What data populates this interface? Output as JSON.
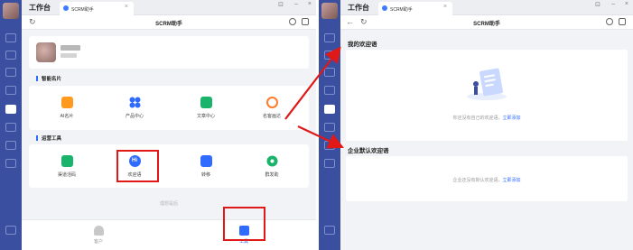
{
  "left_window": {
    "workspace_title": "工作台",
    "tab_label": "SCRM助手",
    "nav_title": "SCRM助手",
    "sections": [
      {
        "title": "智能名片",
        "items": [
          {
            "label": "AI名片",
            "icon": "ai-card-icon",
            "color": "#ff9a1f"
          },
          {
            "label": "产品中心",
            "icon": "product-center-icon",
            "color": "#2f6bff"
          },
          {
            "label": "文章中心",
            "icon": "article-center-icon",
            "color": "#19b36b"
          },
          {
            "label": "名客画达",
            "icon": "customer-profile-icon",
            "color": "#ff7a29"
          }
        ]
      },
      {
        "title": "运营工具",
        "items": [
          {
            "label": "渠道活码",
            "icon": "channel-code-icon",
            "color": "#19b36b"
          },
          {
            "label": "欢迎语",
            "icon": "welcome-message-icon",
            "color": "#2f6bff"
          },
          {
            "label": "转移",
            "icon": "transfer-icon",
            "color": "#2f6bff"
          },
          {
            "label": "群发助",
            "icon": "mass-send-icon",
            "color": "#19b36b"
          }
        ]
      }
    ],
    "hint": "理想是后",
    "bottom_tabs": [
      {
        "label": "客户",
        "icon": "customer-tab-icon"
      },
      {
        "label": "工具",
        "icon": "tools-tab-icon"
      }
    ]
  },
  "right_window": {
    "workspace_title": "工作台",
    "tab_label": "SCRM助手",
    "nav_title": "SCRM助手",
    "my_welcome": {
      "title": "我的欢迎语",
      "empty_text": "你还没有自己的欢迎语，",
      "action": "立即添加"
    },
    "corp_welcome": {
      "title": "企业默认欢迎语",
      "empty_text": "企业还没有默认欢迎语，",
      "action": "立即添加"
    }
  },
  "colors": {
    "rail": "#3a4fa0",
    "accent": "#2f6bff",
    "highlight": "#e01818"
  }
}
